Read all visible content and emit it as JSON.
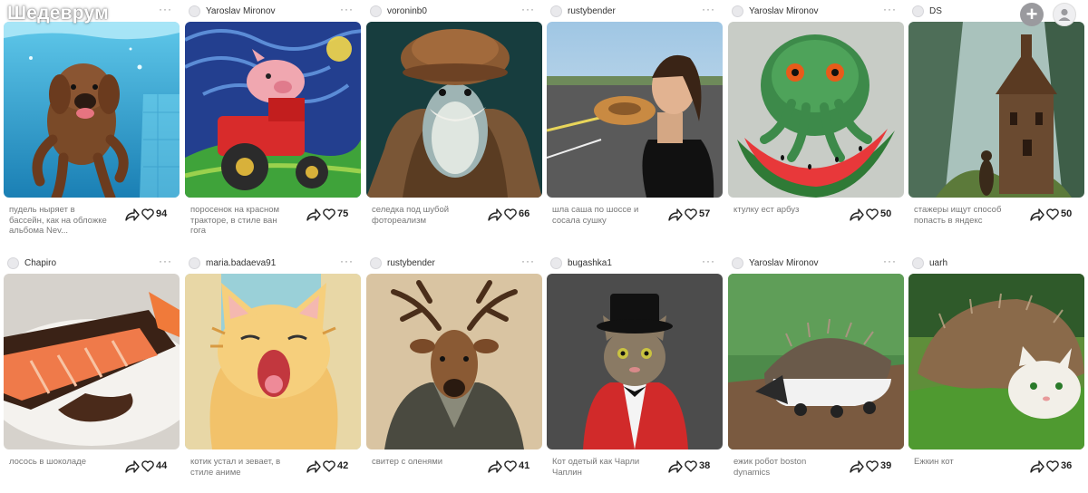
{
  "app": {
    "logo": "Шедеврум",
    "add_icon": "+",
    "profile_icon": "user-icon",
    "more_icon": "···",
    "share_icon": "share-icon",
    "like_icon": "heart-icon"
  },
  "cards": [
    {
      "author": "",
      "caption": "пудель ныряет в бассейн, как на обложке альбома Nev...",
      "likes": "94",
      "image": "poodle-underwater"
    },
    {
      "author": "Yaroslav Mironov",
      "caption": "поросенок на красном тракторе, в стиле ван гога",
      "likes": "75",
      "image": "pig-tractor"
    },
    {
      "author": "voroninb0",
      "caption": "селедка под шубой фотореализм",
      "likes": "66",
      "image": "herring-fur-coat"
    },
    {
      "author": "rustybender",
      "caption": "шла саша по шоссе и сосала сушку",
      "likes": "57",
      "image": "woman-bagel-road"
    },
    {
      "author": "Yaroslav Mironov",
      "caption": "ктулку ест арбуз",
      "likes": "50",
      "image": "cthulhu-watermelon"
    },
    {
      "author": "DS",
      "caption": "стажеры ищут способ попасть в яндекс",
      "likes": "50",
      "image": "castle-forest"
    },
    {
      "author": "Chapiro",
      "caption": "лосось в шоколаде",
      "likes": "44",
      "image": "salmon-chocolate"
    },
    {
      "author": "maria.badaeva91",
      "caption": "котик устал и зевает, в стиле аниме",
      "likes": "42",
      "image": "anime-cat-yawn"
    },
    {
      "author": "rustybender",
      "caption": "свитер с оленями",
      "likes": "41",
      "image": "deer-sweater"
    },
    {
      "author": "bugashka1",
      "caption": "Кот одетый как Чарли Чаплин",
      "likes": "38",
      "image": "cat-top-hat"
    },
    {
      "author": "Yaroslav Mironov",
      "caption": "ежик робот boston dynamics",
      "likes": "39",
      "image": "robot-hedgehog"
    },
    {
      "author": "uarh",
      "caption": "Ежкин кот",
      "likes": "36",
      "image": "hedgehog-cat"
    }
  ]
}
